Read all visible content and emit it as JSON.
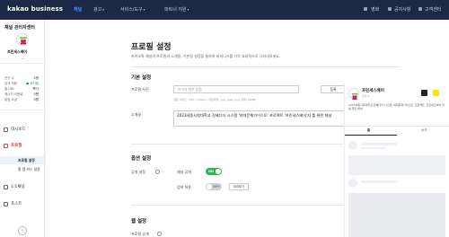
{
  "topbar": {
    "logo": "kakao business",
    "nav": [
      {
        "label": "채널"
      },
      {
        "label": "광고"
      },
      {
        "label": "서비스/도구"
      },
      {
        "label": "파트너 지원"
      }
    ],
    "right": [
      {
        "label": "영화"
      },
      {
        "label": "공지사항"
      },
      {
        "label": "고객센터"
      }
    ],
    "colors": {
      "bg": "#1c2844",
      "active": "#4d8cff"
    }
  },
  "sidebar": {
    "title": "채널 관리자센터",
    "channel_name": "프린세스베어",
    "stats": [
      {
        "label": "친구 수",
        "value": "5명"
      },
      {
        "label": "검색 허용",
        "value": "● 하시됨"
      },
      {
        "label": "홈 URL",
        "value": "복사"
      },
      {
        "label": "메시지 이용료",
        "value": "0원"
      },
      {
        "label": "알림 요금",
        "value": "0원"
      }
    ],
    "menu": [
      {
        "label": "대시보드"
      },
      {
        "label": "프로필"
      },
      {
        "label": "1:1채팅"
      },
      {
        "label": "포스트"
      }
    ],
    "profile_sub": [
      {
        "label": "프로필 설정"
      },
      {
        "label": "홈 탭 카드 설정"
      }
    ],
    "accent": "#e53e3e"
  },
  "main": {
    "title": "프로필 설정",
    "description": "카카오톡 채널의 프로필과 소개말, 기본정 설정을 통하여 비지니스를 더욱 효과적으로 나타내보세요.",
    "basic_section": "기본 설정",
    "profile_photo_label": "프로필 사진",
    "profile_photo_placeholder": "이미지 첨부 없음",
    "register_button": "등록",
    "photo_hint": "권장 사이즈 : 640 x 640px / 지원파일 : jpg, jpeg, png (최대 10MB)",
    "intro_label": "소개글",
    "intro_text": "2023세종시창대학교 장혜디더 시스템 '여대문제가이스토' 프로젝트 '프린세스베어'지 를 위한 채널",
    "option_section": "옵션 설정",
    "public_label": "공개 설정",
    "channel_public_label": "채널 공개",
    "toggle_on": "ON",
    "search_allow_label": "검색 허용",
    "toggle_off": "OFF",
    "preview_button": "미리보기",
    "web_section": "웹 설정",
    "web_label": "프로필 공개"
  },
  "preview": {
    "name": "프린세스베어",
    "sub": "친구 5",
    "description": "2023세종시창대학교 장혜디더 시스템 '여대문제가이스토' 프로젝트 '프린세스베어'지 를 위한 채널",
    "tab_home": "홈",
    "tab_news": "소식",
    "colors": {
      "kakao_yellow": "#fee500",
      "dark": "#222222",
      "berry": "#c51a4a",
      "leaf": "#6cc04a"
    }
  }
}
